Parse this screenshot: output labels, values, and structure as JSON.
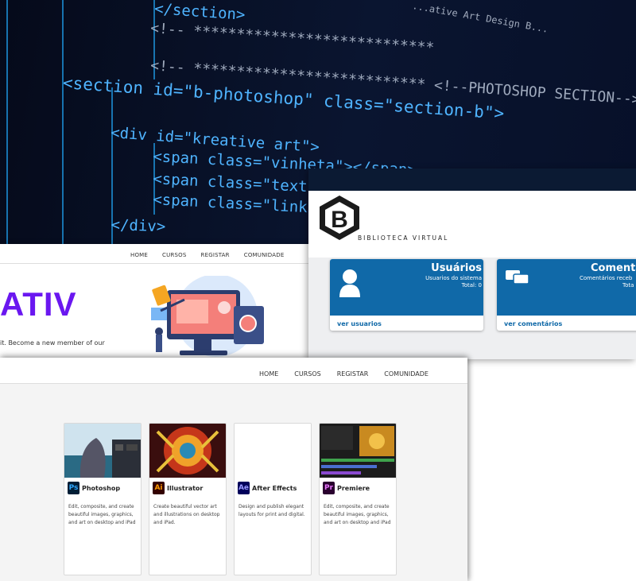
{
  "code": {
    "lines": [
      "</section>",
      "<!-- ****************************",
      "<!-- *************************** <!--PHOTOSHOP SECTION-->",
      "<section id=\"b-photoshop\" class=\"section-b\">",
      "<div id=\"kreative art\">",
      "<span class=\"vinheta\"></span>",
      "<span class=\"text\"><",
      "<span class=\"link\"",
      "</div>"
    ],
    "small_top_right": "...ative Art Design B..."
  },
  "kreativ": {
    "nav": [
      "HOME",
      "CURSOS",
      "REGISTAR",
      "COMUNIDADE"
    ],
    "brand_partial": "ATIV",
    "tagline": "it. Become a new member of our"
  },
  "biblioteca": {
    "logo_letter": "B",
    "logo_text": "BIBLIOTECA VIRTUAL",
    "cards": [
      {
        "title": "Usuários",
        "subtitle": "Usuarios do sistema",
        "total": "Total: 0",
        "link": "ver usuarios"
      },
      {
        "title": "Comentár",
        "subtitle": "Comentários receb",
        "total": "Tota",
        "link": "ver comentários"
      }
    ]
  },
  "courses": {
    "nav": [
      "HOME",
      "CURSOS",
      "REGISTAR",
      "COMUNIDADE"
    ],
    "items": [
      {
        "abbr": "Ps",
        "name": "Photoshop",
        "desc": "Edit, composite, and create beautiful images, graphics, and art on desktop and iPad",
        "color": "#31a8ff",
        "bg": "#001e36"
      },
      {
        "abbr": "Ai",
        "name": "Illustrator",
        "desc": "Create beautiful vector art and illustrations on desktop and iPad.",
        "color": "#ff9a00",
        "bg": "#330000"
      },
      {
        "abbr": "Ae",
        "name": "After Effects",
        "desc": "Design and publish elegant layouts for print and digital.",
        "color": "#9999ff",
        "bg": "#00005b"
      },
      {
        "abbr": "Pr",
        "name": "Premiere",
        "desc": "Edit, composite, and create beautiful images, graphics, and art on desktop and iPad",
        "color": "#ea77ff",
        "bg": "#2a002f"
      }
    ]
  },
  "colors": {
    "brand_purple": "#6a17f0",
    "biblioteca_blue": "#1069a8",
    "code_bg": "#050a1a"
  }
}
